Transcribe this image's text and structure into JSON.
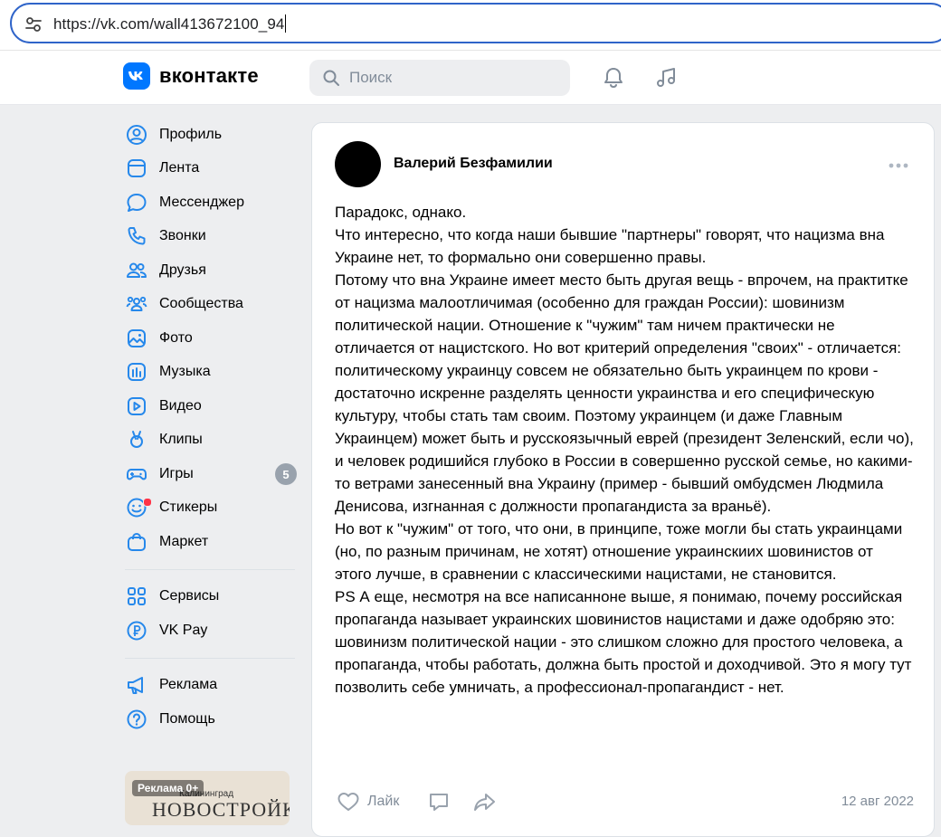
{
  "browser": {
    "url": "https://vk.com/wall413672100_94"
  },
  "header": {
    "logo_text": "вконтакте",
    "search_placeholder": "Поиск"
  },
  "sidebar": {
    "items": [
      {
        "label": "Профиль",
        "icon": "profile-icon"
      },
      {
        "label": "Лента",
        "icon": "feed-icon"
      },
      {
        "label": "Мессенджер",
        "icon": "messenger-icon"
      },
      {
        "label": "Звонки",
        "icon": "phone-icon"
      },
      {
        "label": "Друзья",
        "icon": "friends-icon"
      },
      {
        "label": "Сообщества",
        "icon": "communities-icon"
      },
      {
        "label": "Фото",
        "icon": "photo-icon"
      },
      {
        "label": "Музыка",
        "icon": "music-icon"
      },
      {
        "label": "Видео",
        "icon": "video-icon"
      },
      {
        "label": "Клипы",
        "icon": "clips-icon"
      },
      {
        "label": "Игры",
        "icon": "games-icon",
        "badge": "5"
      },
      {
        "label": "Стикеры",
        "icon": "stickers-icon"
      },
      {
        "label": "Маркет",
        "icon": "market-icon"
      }
    ],
    "group2": [
      {
        "label": "Сервисы",
        "icon": "services-icon"
      },
      {
        "label": "VK Pay",
        "icon": "vkpay-icon"
      }
    ],
    "group3": [
      {
        "label": "Реклама",
        "icon": "ads-icon"
      },
      {
        "label": "Помощь",
        "icon": "help-icon"
      }
    ],
    "ad": {
      "label": "Реклама 0+",
      "city": "Калининград",
      "title": "НОВОСТРОЙКИ"
    }
  },
  "post": {
    "author": "Валерий Безфамилии",
    "paragraphs": [
      "Парадокс, однако.",
      "Что интересно, что когда наши бывшие \"партнеры\" говорят, что нацизма вна Украине нет, то формально они совершенно правы.",
      "Потому что вна Украине имеет место быть другая вещь - впрочем, на практитке от нацизма малоотличимая (особенно для граждан России): шовинизм политической нации. Отношение к \"чужим\" там ничем практически не отличается от нацистского. Но вот критерий определения \"своих\" - отличается: политическому украинцу совсем не обязательно быть украинцем по крови - достаточно искренне разделять ценности украинства и его специфическую культуру, чтобы стать там своим. Поэтому украинцем (и даже Главным Украинцем) может быть и русскоязычный еврей (президент Зеленский, если чо), и человек родишийся глубоко в России в совершенно русской семье, но какими-то ветрами занесенный вна Украину (пример - бывший омбудсмен Людмила Денисова, изгнанная с должности пропагандиста за враньё).",
      "Но вот к \"чужим\" от того, что они, в принципе, тоже могли бы стать украинцами (но, по разным причинам, не хотят) отношение украинскиих шовинистов от этого лучше, в сравнении с классическими нацистами, не становится.",
      "PS А еще, несмотря на все написанноне выше, я понимаю, почему российская пропаганда называет украинских шовинистов нацистами и даже одобряю это: шовинизм политической нации - это слишком сложно для простого человека, а пропаганда, чтобы работать, должна быть простой и доходчивой. Это я могу тут позволить себе умничать, а профессионал-пропагандист - нет."
    ],
    "like_label": "Лайк",
    "date": "12 авг 2022"
  },
  "colors": {
    "accent": "#0077ff",
    "badge": "#99a2ad",
    "url_border": "#2f64c9"
  }
}
